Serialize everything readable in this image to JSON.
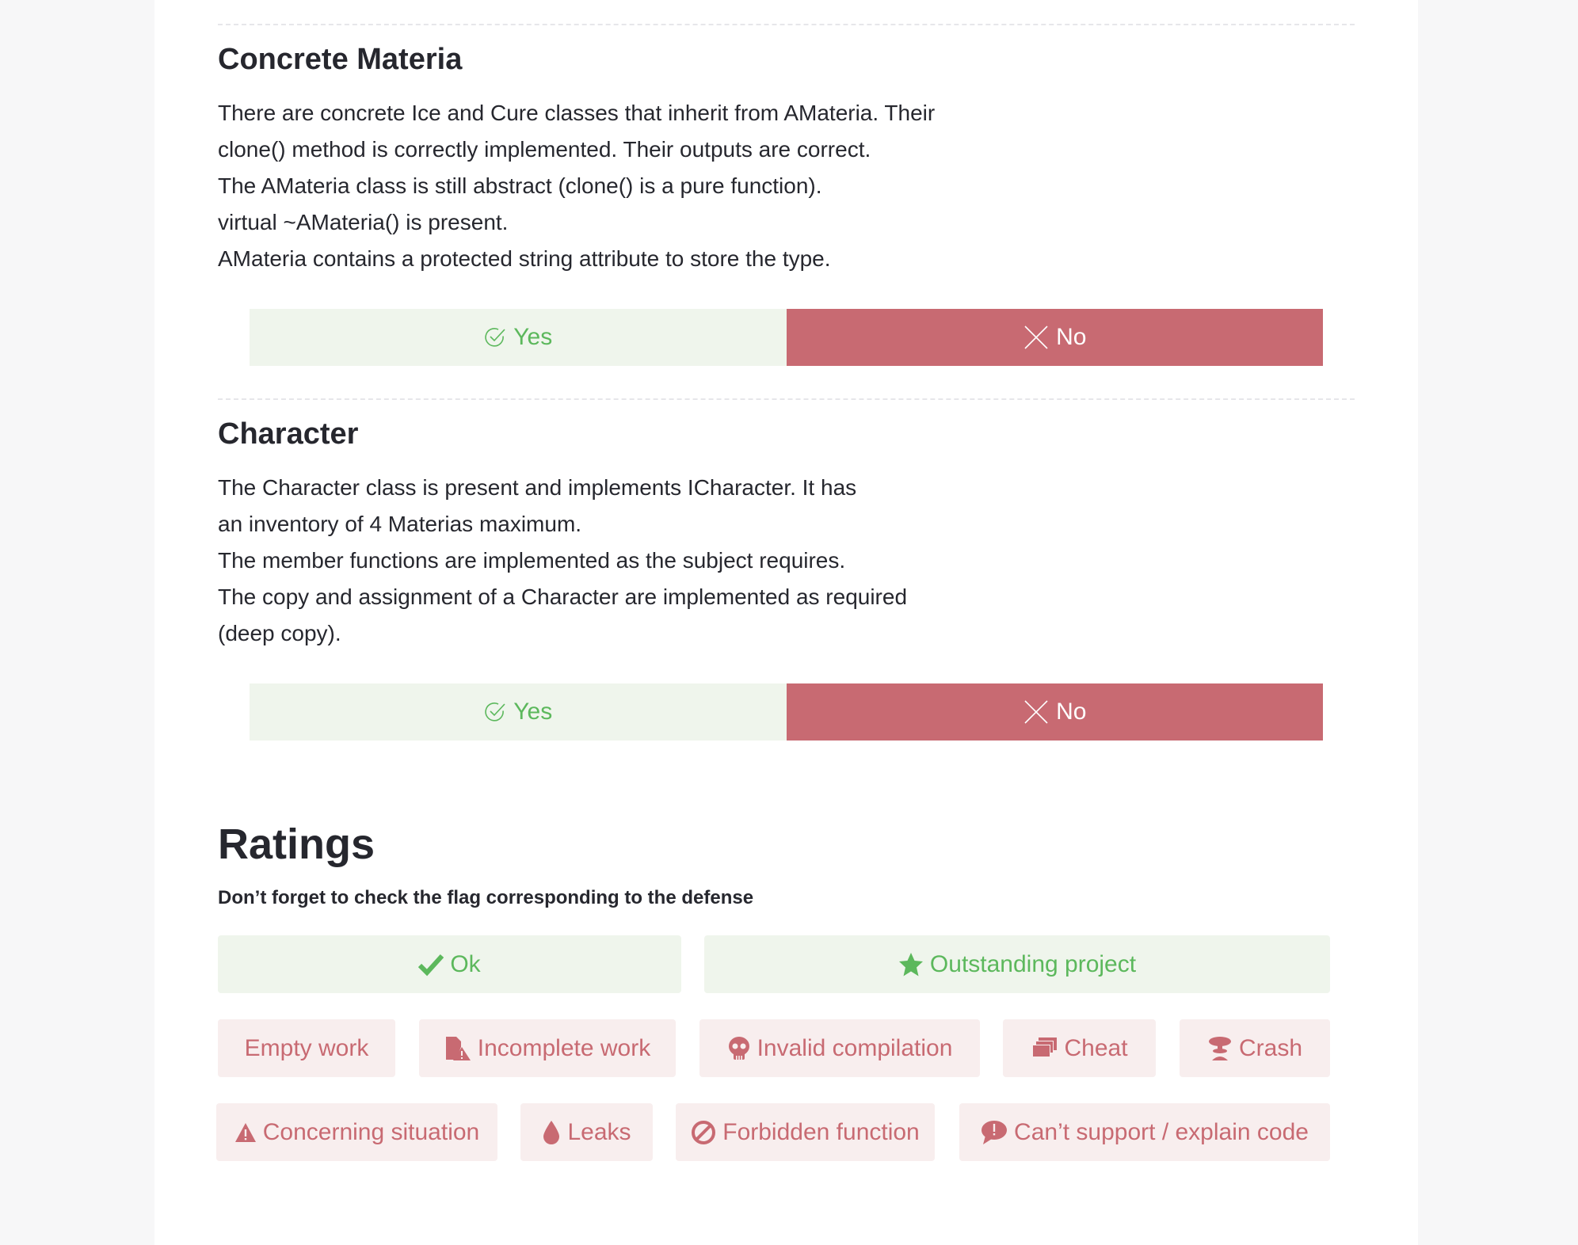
{
  "sections": [
    {
      "title": "Concrete Materia",
      "lines": [
        "There are concrete Ice and Cure classes that inherit from AMateria. Their",
        "clone() method is correctly implemented. Their outputs are correct.",
        "The AMateria class is still abstract (clone() is a pure function).",
        "virtual ~AMateria() is present.",
        "AMateria contains a protected string attribute to store the type."
      ],
      "yes_label": "Yes",
      "no_label": "No"
    },
    {
      "title": "Character",
      "lines": [
        "The Character class is present and implements ICharacter. It has",
        "an inventory of 4 Materias maximum.",
        "The member functions are implemented as the subject requires.",
        "The copy and assignment of a Character are implemented as required",
        "(deep copy)."
      ],
      "yes_label": "Yes",
      "no_label": "No"
    }
  ],
  "ratings": {
    "title": "Ratings",
    "subtitle": "Don’t forget to check the flag corresponding to the defense",
    "flags": {
      "ok": {
        "label": "Ok",
        "icon": "checkmark-icon"
      },
      "outstanding": {
        "label": "Outstanding project",
        "icon": "star-icon"
      },
      "empty": {
        "label": "Empty work"
      },
      "incomplete": {
        "label": "Incomplete work",
        "icon": "file-warning-icon"
      },
      "invalid": {
        "label": "Invalid compilation",
        "icon": "skull-icon"
      },
      "cheat": {
        "label": "Cheat",
        "icon": "copy-stack-icon"
      },
      "crash": {
        "label": "Crash",
        "icon": "explosion-icon"
      },
      "concerning": {
        "label": "Concerning situation",
        "icon": "warning-triangle-icon"
      },
      "leaks": {
        "label": "Leaks",
        "icon": "droplet-icon"
      },
      "forbidden": {
        "label": "Forbidden function",
        "icon": "ban-icon"
      },
      "cant_support": {
        "label": "Can’t support / explain code",
        "icon": "speech-bubble-icon"
      }
    }
  },
  "colors": {
    "positive": "#5cb85c",
    "positive_bg": "#eff5ec",
    "negative": "#c86a72",
    "negative_bg": "#f8eeee"
  }
}
